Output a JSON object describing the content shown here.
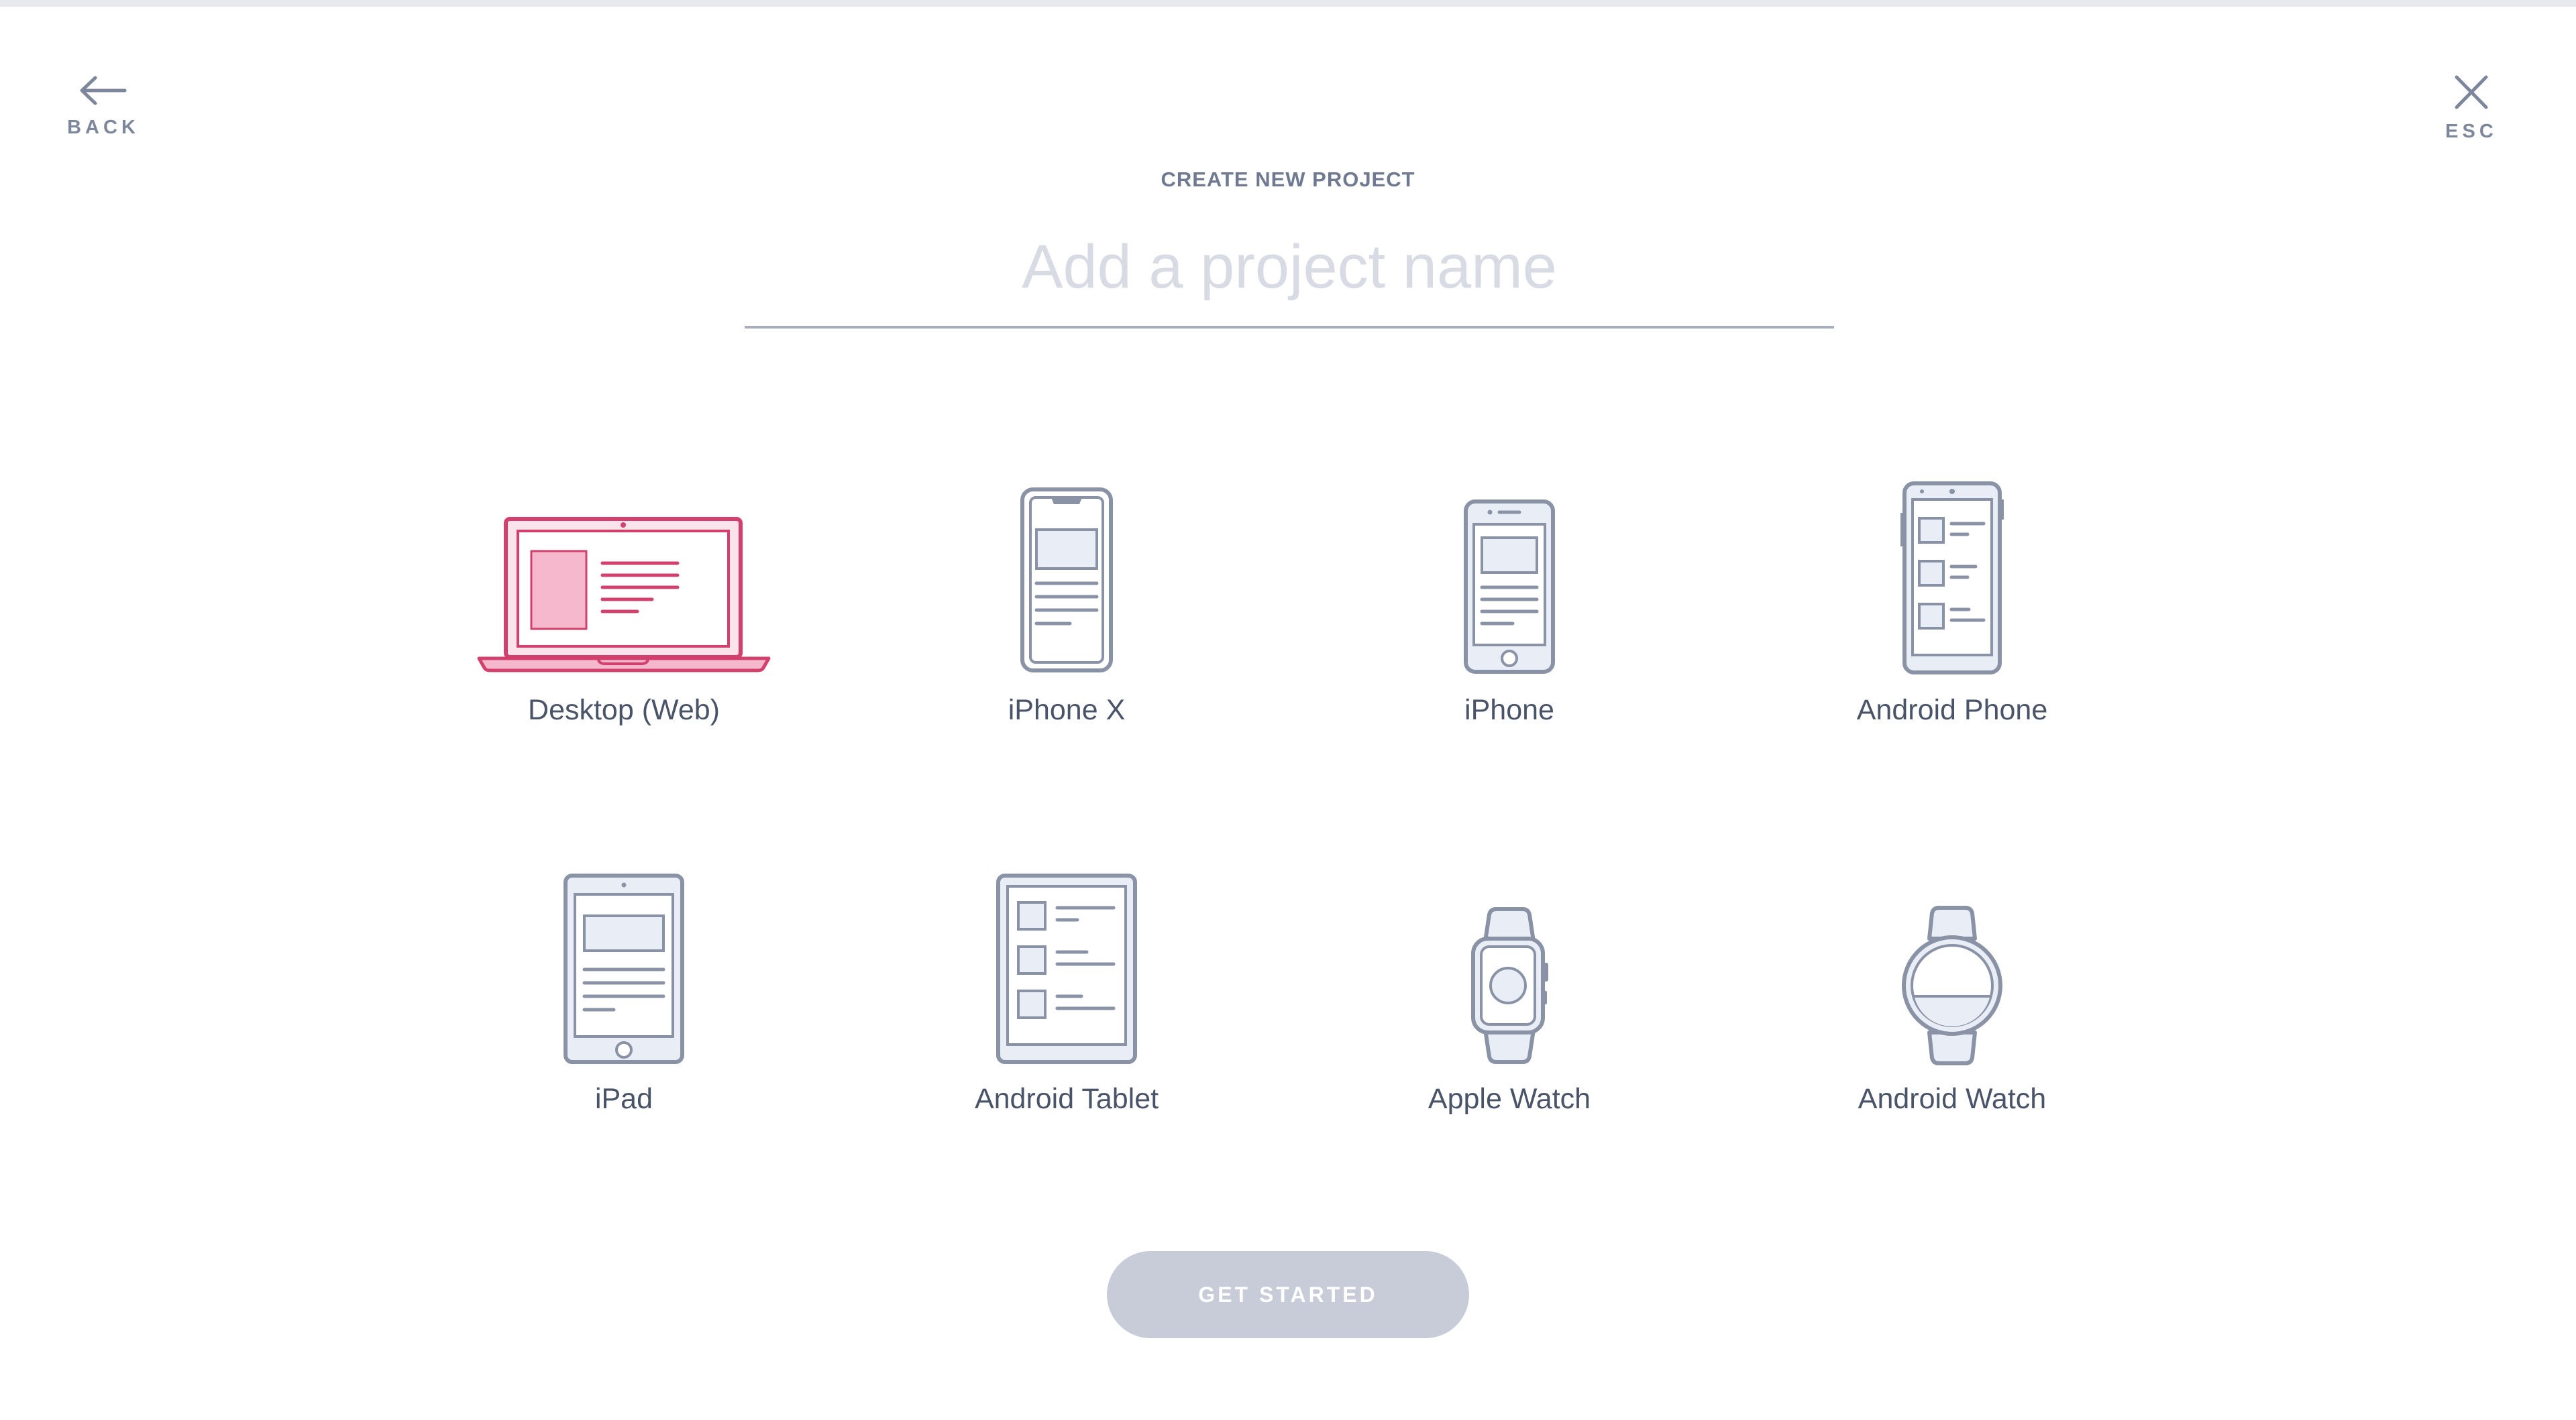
{
  "nav": {
    "back_label": "BACK",
    "esc_label": "ESC"
  },
  "header": {
    "title": "CREATE NEW PROJECT"
  },
  "project_name": {
    "placeholder": "Add a project name",
    "value": ""
  },
  "devices": [
    {
      "label": "Desktop (Web)",
      "icon": "laptop-icon",
      "selected": true
    },
    {
      "label": "iPhone X",
      "icon": "iphone-x-icon",
      "selected": false
    },
    {
      "label": "iPhone",
      "icon": "iphone-icon",
      "selected": false
    },
    {
      "label": "Android Phone",
      "icon": "android-phone-icon",
      "selected": false
    },
    {
      "label": "iPad",
      "icon": "ipad-icon",
      "selected": false
    },
    {
      "label": "Android Tablet",
      "icon": "android-tablet-icon",
      "selected": false
    },
    {
      "label": "Apple Watch",
      "icon": "apple-watch-icon",
      "selected": false
    },
    {
      "label": "Android Watch",
      "icon": "android-watch-icon",
      "selected": false
    }
  ],
  "cta": {
    "label": "GET STARTED",
    "enabled": false
  },
  "colors": {
    "accent": "#d2416e",
    "accent_fill": "#f6b8cd",
    "icon_stroke": "#8a93a6",
    "icon_fill": "#e9eef6",
    "cta_disabled": "#c7ccd8"
  }
}
